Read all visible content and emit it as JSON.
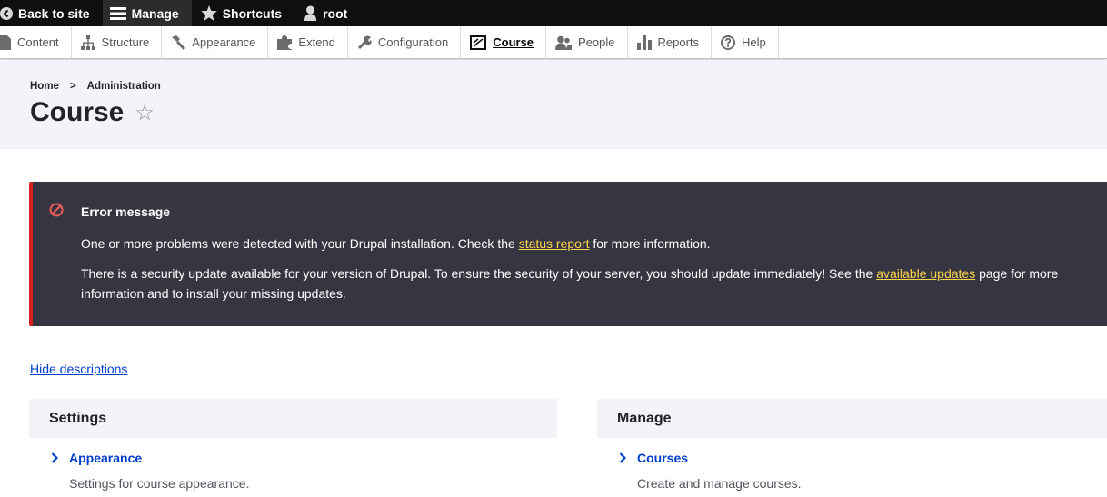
{
  "toolbar": {
    "back_label": "Back to site",
    "manage_label": "Manage",
    "shortcuts_label": "Shortcuts",
    "user_label": "root"
  },
  "tray": {
    "items": [
      {
        "label": "Content",
        "icon": "content-icon"
      },
      {
        "label": "Structure",
        "icon": "structure-icon"
      },
      {
        "label": "Appearance",
        "icon": "appearance-icon"
      },
      {
        "label": "Extend",
        "icon": "extend-icon"
      },
      {
        "label": "Configuration",
        "icon": "configuration-icon"
      },
      {
        "label": "Course",
        "icon": "course-icon",
        "active": true
      },
      {
        "label": "People",
        "icon": "people-icon"
      },
      {
        "label": "Reports",
        "icon": "reports-icon"
      },
      {
        "label": "Help",
        "icon": "help-icon"
      }
    ]
  },
  "breadcrumb": {
    "home": "Home",
    "separator": ">",
    "current": "Administration"
  },
  "page": {
    "title": "Course",
    "star": "☆"
  },
  "error": {
    "title": "Error message",
    "line1_before": "One or more problems were detected with your Drupal installation. Check the ",
    "line1_link": "status report",
    "line1_after": " for more information.",
    "line2_before": "There is a security update available for your version of Drupal. To ensure the security of your server, you should update immediately! See the ",
    "line2_link": "available updates",
    "line2_after": " page for more information and to install your missing updates."
  },
  "hide_descriptions": "Hide descriptions",
  "panels": {
    "settings": {
      "title": "Settings",
      "link": "Appearance",
      "desc": "Settings for course appearance."
    },
    "manage": {
      "title": "Manage",
      "link": "Courses",
      "desc": "Create and manage courses."
    }
  },
  "colors": {
    "toolbar_bg": "#0f0f0f",
    "error_bg": "#353641",
    "error_accent": "#d72222",
    "link": "#003ecc",
    "warning_link": "#fed54d"
  }
}
